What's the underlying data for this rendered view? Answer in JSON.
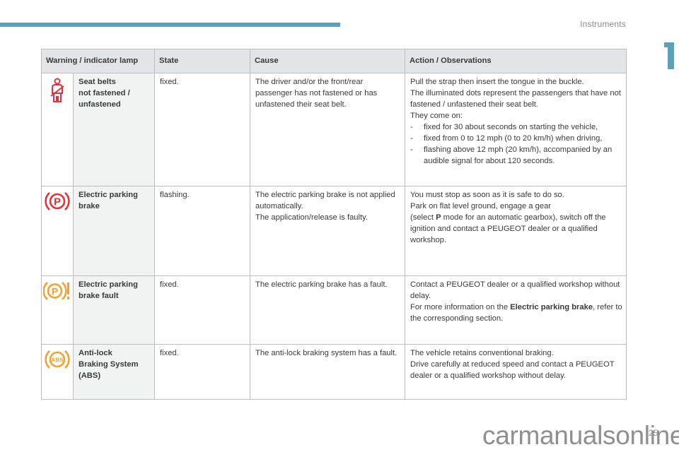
{
  "header": {
    "section_title": "Instruments",
    "chapter_number": "1",
    "accent_color": "#5fa0b8"
  },
  "table": {
    "columns": [
      "Warning / indicator lamp",
      "State",
      "Cause",
      "Action / Observations"
    ],
    "rows": [
      {
        "icon": "seat-belt-icon",
        "icon_color": "#e53238",
        "name_lines": [
          "Seat belts",
          "not fastened /",
          "unfastened"
        ],
        "state": "fixed.",
        "cause": "The driver and/or the front/rear passenger has not fastened or has unfastened their seat belt.",
        "action": {
          "lines": [
            "Pull the strap then insert the tongue in the buckle.",
            "The illuminated dots represent the passengers that have not fastened / unfastened their seat belt.",
            "They come on:"
          ],
          "bullets": [
            "fixed for 30 about seconds on starting the vehicle,",
            "fixed from 0 to 12 mph (0 to 20 km/h) when driving,",
            "flashing above 12 mph (20 km/h), accompanied by an audible signal for about 120 seconds."
          ]
        }
      },
      {
        "icon": "parking-brake-icon",
        "icon_color": "#e53238",
        "name_lines": [
          "Electric parking",
          "brake"
        ],
        "state": "flashing.",
        "cause_lines": [
          "The electric parking brake is not applied automatically.",
          "The application/release is faulty."
        ],
        "action": {
          "line1": "You must stop as soon as it is safe to do so.",
          "line2": "Park on flat level ground, engage a gear",
          "line3_pre": "(select ",
          "line3_bold": "P",
          "line3_post": " mode for an automatic gearbox), switch off the ignition and contact a PEUGEOT dealer or a qualified workshop."
        }
      },
      {
        "icon": "parking-brake-fault-icon",
        "icon_color": "#f4a22d",
        "name_lines": [
          "Electric parking",
          "brake fault"
        ],
        "state": "fixed.",
        "cause": "The electric parking brake has a fault.",
        "action": {
          "line1": "Contact a PEUGEOT dealer or a qualified workshop without delay.",
          "line2_pre": "For more information on the ",
          "line2_bold": "Electric parking brake",
          "line2_post": ", refer to the corresponding section."
        }
      },
      {
        "icon": "abs-icon",
        "icon_color": "#f4a22d",
        "icon_text": "ABS",
        "name_lines": [
          "Anti-lock",
          "Braking System",
          "(ABS)"
        ],
        "state": "fixed.",
        "cause": "The anti-lock braking system has a fault.",
        "action": {
          "lines": [
            "The vehicle retains conventional braking.",
            "Drive carefully at reduced speed and contact a PEUGEOT dealer or a qualified workshop without delay."
          ]
        }
      }
    ]
  },
  "footer": {
    "page_number": "25",
    "watermark": "carmanualsonline.info"
  }
}
